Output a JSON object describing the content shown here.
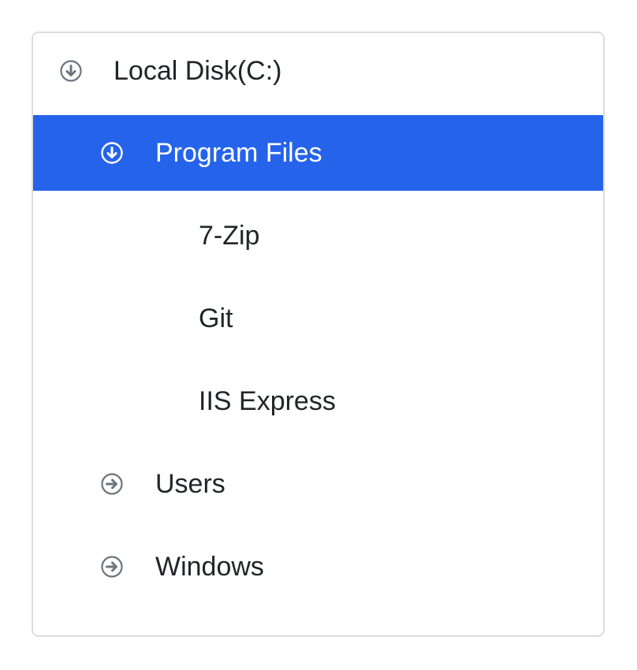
{
  "tree": {
    "nodes": [
      {
        "label": "Local Disk(C:)",
        "icon": "expanded-circle-arrow-down-icon"
      },
      {
        "label": "Program Files",
        "icon": "expanded-circle-arrow-down-icon",
        "selected": true
      },
      {
        "label": "7-Zip"
      },
      {
        "label": "Git"
      },
      {
        "label": "IIS Express"
      },
      {
        "label": "Users",
        "icon": "collapsed-circle-arrow-right-icon"
      },
      {
        "label": "Windows",
        "icon": "collapsed-circle-arrow-right-icon"
      }
    ]
  },
  "colors": {
    "selected_background": "#2563eb",
    "selected_text": "#ffffff",
    "text": "#212529",
    "icon": "#6c757d",
    "border": "#dcdcdc"
  }
}
